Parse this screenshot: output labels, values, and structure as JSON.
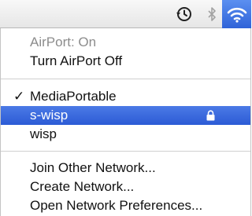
{
  "menubar": {
    "icons": [
      "time-machine-icon",
      "bluetooth-icon",
      "wifi-icon"
    ]
  },
  "menu": {
    "status": "AirPort: On",
    "toggle": "Turn AirPort Off",
    "networks": [
      {
        "name": "MediaPortable",
        "checked": true,
        "locked": false
      },
      {
        "name": "s-wisp",
        "checked": false,
        "locked": true,
        "highlighted": true
      },
      {
        "name": "wisp",
        "checked": false,
        "locked": false
      }
    ],
    "check_mark": "✓",
    "actions": [
      "Join Other Network...",
      "Create Network...",
      "Open Network Preferences..."
    ]
  },
  "colors": {
    "highlight": "#2c5bd5",
    "disabled_text": "#8c8c8c"
  }
}
